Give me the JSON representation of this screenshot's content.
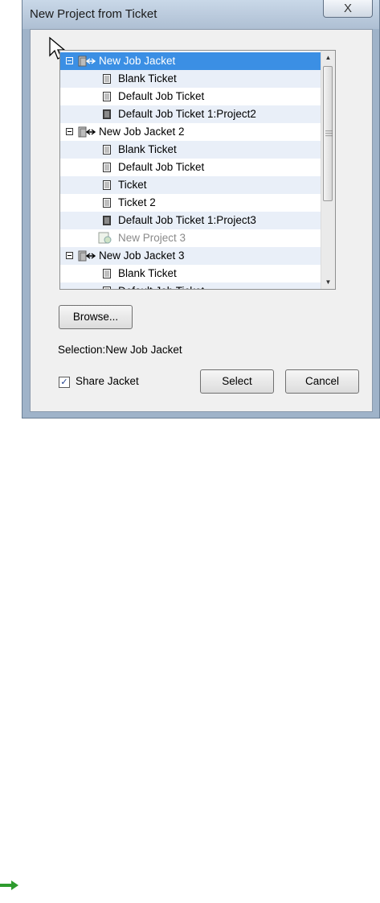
{
  "dialog": {
    "title": "New Project from Ticket",
    "close_glyph": "X"
  },
  "tree": {
    "items": [
      {
        "label": "New Job Jacket",
        "level": 0,
        "type": "jacket",
        "expanded": true,
        "selected": true
      },
      {
        "label": "Blank Ticket",
        "level": 1,
        "type": "ticket"
      },
      {
        "label": "Default Job Ticket",
        "level": 1,
        "type": "ticket"
      },
      {
        "label": "Default Job Ticket 1:Project2",
        "level": 1,
        "type": "ticket-dark"
      },
      {
        "label": "New Job Jacket 2",
        "level": 0,
        "type": "jacket",
        "expanded": true
      },
      {
        "label": "Blank Ticket",
        "level": 1,
        "type": "ticket"
      },
      {
        "label": "Default Job Ticket",
        "level": 1,
        "type": "ticket"
      },
      {
        "label": "Ticket",
        "level": 1,
        "type": "ticket"
      },
      {
        "label": "Ticket 2",
        "level": 1,
        "type": "ticket"
      },
      {
        "label": "Default Job Ticket 1:Project3",
        "level": 1,
        "type": "ticket-dark"
      },
      {
        "label": "New Project 3",
        "level": 1,
        "type": "drag-ghost"
      },
      {
        "label": "New Job Jacket 3",
        "level": 0,
        "type": "jacket",
        "expanded": true
      },
      {
        "label": "Blank Ticket",
        "level": 1,
        "type": "ticket"
      },
      {
        "label": "Default Job Ticket",
        "level": 1,
        "type": "ticket",
        "partially_visible": true
      }
    ]
  },
  "buttons": {
    "browse": "Browse...",
    "select": "Select",
    "cancel": "Cancel"
  },
  "selection": {
    "prefix": "Selection:",
    "value": "New Job Jacket"
  },
  "share_jacket": {
    "label": "Share Jacket",
    "checked": true,
    "check_glyph": "✓"
  },
  "icons": {
    "jacket": "job-jacket-icon",
    "ticket": "ticket-icon",
    "footer": "green-arrow-icon"
  },
  "colors": {
    "selection": "#3b8fe4",
    "alt_row": "#e9eff8",
    "arrow": "#2e9b2e"
  }
}
